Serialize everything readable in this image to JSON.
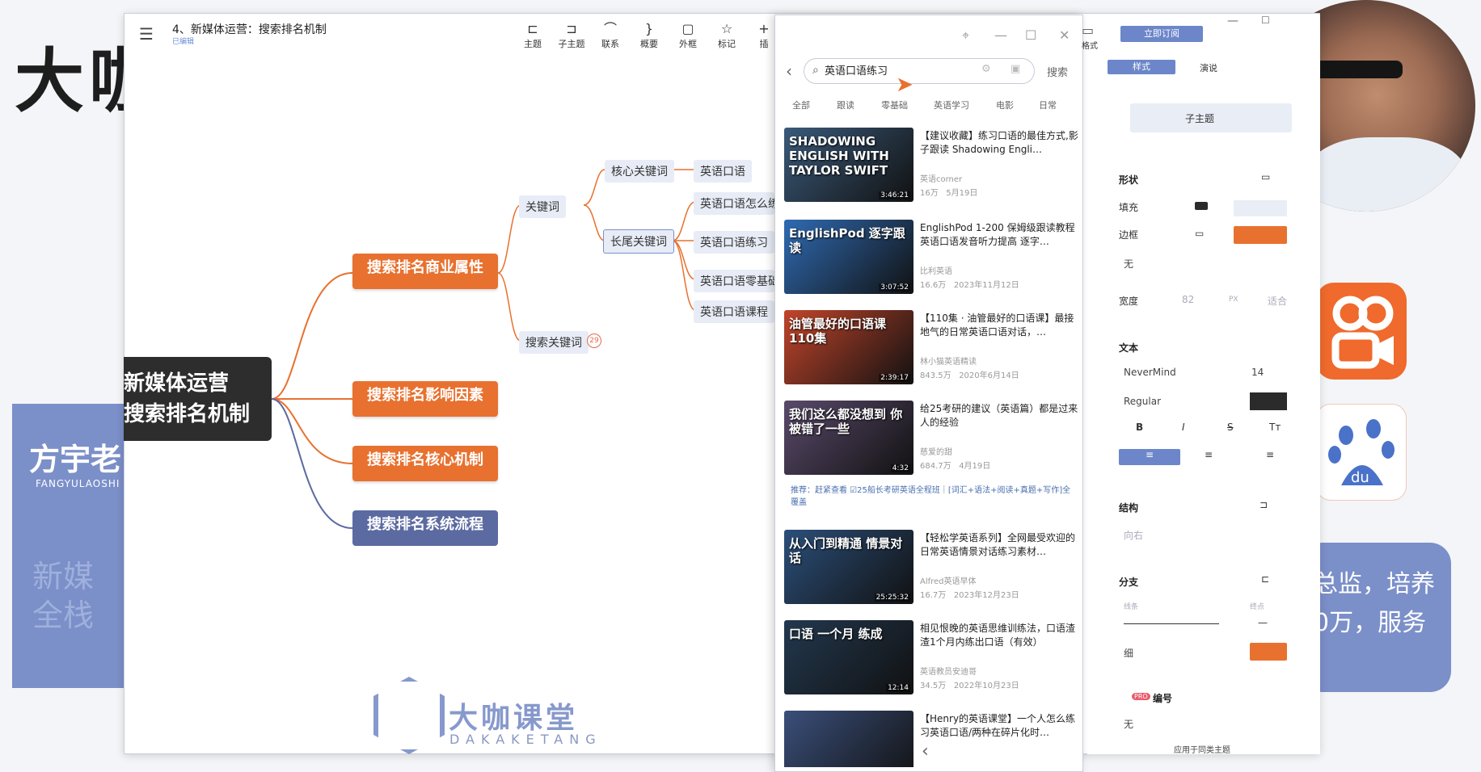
{
  "background": {
    "big_title": "大咖",
    "faint_title": "",
    "teacher_name": "方宇老",
    "teacher_pinyin": "FANGYULAOSHI",
    "faint_text": "新媒全栈",
    "right_text": "总监，培养 0万，服务"
  },
  "app": {
    "doc_title": "4、新媒体运营：搜索排名机制",
    "doc_sub": "已编辑",
    "toolbar": [
      {
        "label": "主题",
        "icon": "⊏"
      },
      {
        "label": "子主题",
        "icon": "⊐"
      },
      {
        "label": "联系",
        "icon": "⌒"
      },
      {
        "label": "概要",
        "icon": "}"
      },
      {
        "label": "外框",
        "icon": "▢"
      },
      {
        "label": "标记",
        "icon": "☆"
      },
      {
        "label": "插",
        "icon": "+"
      }
    ],
    "format_label": "格式"
  },
  "mindmap": {
    "root_line1": "新媒体运营",
    "root_line2": "搜索排名机制",
    "branch1": "搜索排名商业属性",
    "branch2": "搜索排名影响因素",
    "branch3": "搜索排名核心机制",
    "branch4": "搜索排名系统流程",
    "keyword": "关键词",
    "core_keyword": "核心关键词",
    "long_tail": "长尾关键词",
    "search_keyword": "搜索关键词",
    "search_keyword_badge": "29",
    "leaf1": "英语口语",
    "leaf2": "英语口语怎么练",
    "leaf3": "英语口语练习",
    "leaf4": "英语口语零基础",
    "leaf5": "英语口语课程"
  },
  "watermark": {
    "brand": "大咖课堂",
    "sub": "DAKAKETANG"
  },
  "search": {
    "query": "英语口语练习",
    "button": "搜索",
    "tabs": [
      "全部",
      "跟读",
      "零基础",
      "英语学习",
      "电影",
      "日常"
    ],
    "videos": [
      {
        "thumb_text": "SHADOWING ENGLISH WITH TAYLOR SWIFT",
        "duration": "3:46:21",
        "title": "【建议收藏】练习口语的最佳方式,影子跟读 Shadowing Engli…",
        "author": "英语corner",
        "views": "16万",
        "date": "5月19日",
        "color": "#3a5a7a"
      },
      {
        "thumb_text": "EnglishPod 逐字跟读",
        "duration": "3:07:52",
        "title": "EnglishPod 1-200 保姆级跟读教程 英语口语发音听力提高 逐字…",
        "author": "比利英语",
        "views": "16.6万",
        "date": "2023年11月12日",
        "color": "#2f6bb3"
      },
      {
        "thumb_text": "油管最好的口语课 110集",
        "duration": "2:39:17",
        "title": "【110集 · 油管最好的口语课】最接地气的日常英语口语对话，…",
        "author": "林小猫英语精读",
        "views": "843.5万",
        "date": "2020年6月14日",
        "color": "#c2452b"
      },
      {
        "thumb_text": "我们这么都没想到 你被错了一些",
        "duration": "4:32",
        "title": "给25考研的建议（英语篇）都是过来人的经验",
        "author": "慈爱的甜",
        "views": "684.7万",
        "date": "4月19日",
        "color": "#5a4a6b"
      },
      {
        "thumb_text": "从入门到精通 情景对话",
        "duration": "25:25:32",
        "title": "【轻松学英语系列】全网最受欢迎的日常英语情景对话练习素材…",
        "author": "Alfred英语早体",
        "views": "16.7万",
        "date": "2023年12月23日",
        "color": "#2b4f7a"
      },
      {
        "thumb_text": "口语 一个月 练成",
        "duration": "12:14",
        "title": "相见恨晚的英语思维训练法，口语渣渣1个月内练出口语（有效）",
        "author": "英语教员安迪哥",
        "views": "34.5万",
        "date": "2022年10月23日",
        "color": "#22384f"
      },
      {
        "thumb_text": "",
        "duration": "",
        "title": "【Henry的英语课堂】一个人怎么练习英语口语/两种在碎片化时…",
        "author": "",
        "views": "",
        "date": "",
        "color": "#3a4f7a"
      }
    ],
    "recommend": "推荐：赶紧查看 ☑25船长考研英语全程班｜[词汇+语法+阅读+真题+写作]全覆盖"
  },
  "props": {
    "subscribe": "立即订阅",
    "tab_style": "样式",
    "tab_present": "演说",
    "subtopic": "子主题",
    "shape": "形状",
    "fill": "填充",
    "border": "边框",
    "none1": "无",
    "width": "宽度",
    "width_val": "82",
    "width_unit": "PX",
    "fit": "适合",
    "text": "文本",
    "font": "NeverMind",
    "font_size": "14",
    "weight": "Regular",
    "structure": "结构",
    "direction": "向右",
    "branch": "分支",
    "line": "线条",
    "end": "终点",
    "thin": "细",
    "numbering": "编号",
    "pro": "PRO",
    "none2": "无",
    "apply": "应用于同类主题",
    "orange": "#e8712f",
    "dark": "#2b2b2b"
  }
}
